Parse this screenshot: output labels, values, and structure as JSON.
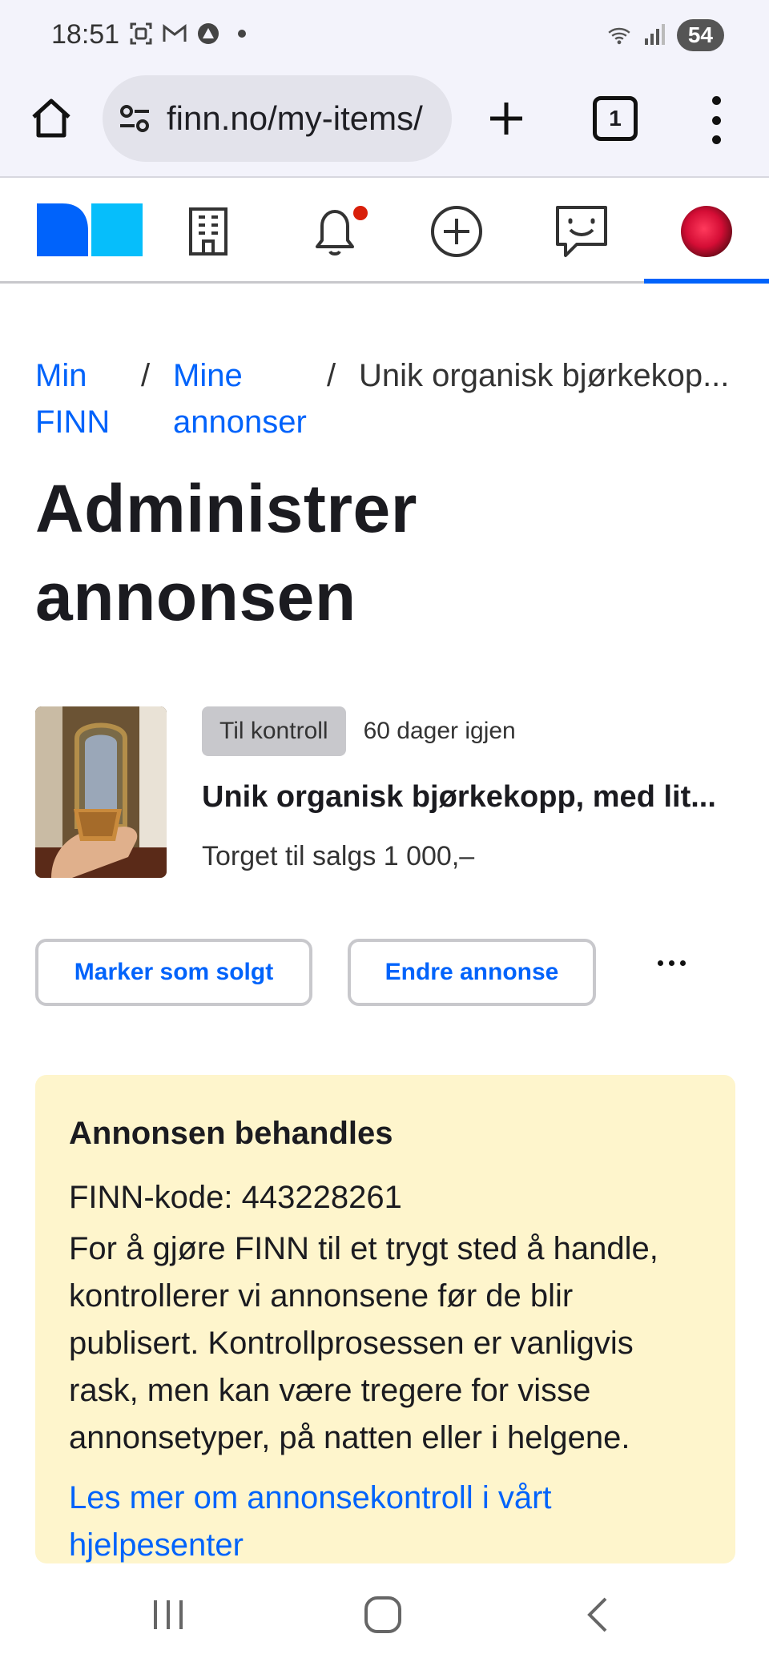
{
  "status_bar": {
    "time": "18:51",
    "battery": "54",
    "icons": [
      "screenshot-icon",
      "gmail-icon",
      "vpn-icon",
      "dot-icon",
      "wifi-icon",
      "signal-icon"
    ]
  },
  "browser": {
    "url": "finn.no/my-items/",
    "tab_count": "1"
  },
  "site_nav": {
    "items": [
      "finn-logo",
      "building-icon",
      "bell-icon",
      "add-circle-icon",
      "chat-icon",
      "avatar"
    ],
    "active_item": "avatar",
    "colors": {
      "logo_dark": "#0063fb",
      "logo_light": "#06befb",
      "notification_dot": "#d91f0a"
    }
  },
  "breadcrumb": {
    "items": [
      {
        "label_line1": "Min",
        "label_line2": "FINN"
      },
      {
        "label_line1": "Mine",
        "label_line2": "annonser"
      }
    ],
    "separator": "/",
    "current": "Unik organisk bjørkekop..."
  },
  "page": {
    "title_line1": "Administrer",
    "title_line2": "annonsen"
  },
  "ad": {
    "status_badge": "Til kontroll",
    "days_left": "60 dager igjen",
    "title": "Unik organisk bjørkekopp, med lit...",
    "price": "Torget til salgs 1 000,–"
  },
  "actions": {
    "mark_sold": "Marker som solgt",
    "edit": "Endre annonse"
  },
  "info": {
    "heading": "Annonsen behandles",
    "code": "FINN-kode: 443228261",
    "body_lines": [
      "For å gjøre FINN til et trygt sted å handle,",
      "kontrollerer vi annonsene før de blir",
      "publisert. Kontrollprosessen er vanligvis",
      "rask, men kan være tregere for visse",
      "annonsetyper, på natten eller i helgene."
    ],
    "link_lines": [
      "Les mer om annonsekontroll i vårt",
      "hjelpesenter"
    ],
    "background": "#fef5cc"
  },
  "accent_color": "#0063fb"
}
